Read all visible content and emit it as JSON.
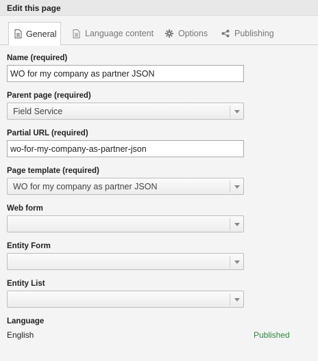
{
  "header": {
    "title": "Edit this page"
  },
  "tabs": [
    {
      "label": "General",
      "icon": "document-icon",
      "active": true
    },
    {
      "label": "Language content",
      "icon": "document-icon",
      "active": false
    },
    {
      "label": "Options",
      "icon": "gear-icon",
      "active": false
    },
    {
      "label": "Publishing",
      "icon": "share-icon",
      "active": false
    }
  ],
  "form": {
    "name": {
      "label": "Name (required)",
      "value": "WO for my company as partner JSON"
    },
    "parent_page": {
      "label": "Parent page (required)",
      "value": "Field Service"
    },
    "partial_url": {
      "label": "Partial URL (required)",
      "value": "wo-for-my-company-as-partner-json"
    },
    "page_template": {
      "label": "Page template (required)",
      "value": "WO for my company as partner JSON"
    },
    "web_form": {
      "label": "Web form",
      "value": ""
    },
    "entity_form": {
      "label": "Entity Form",
      "value": ""
    },
    "entity_list": {
      "label": "Entity List",
      "value": ""
    },
    "language": {
      "label": "Language",
      "value": "English",
      "status": "Published"
    }
  },
  "colors": {
    "status": "#2e8540",
    "header_bg": "#e8e8e8"
  }
}
